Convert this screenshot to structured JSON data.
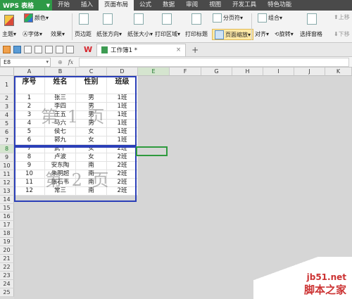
{
  "menubar": {
    "app_label": "WPS 表格",
    "items": [
      "开始",
      "插入",
      "页面布局",
      "公式",
      "数据",
      "审阅",
      "视图",
      "开发工具",
      "特色功能"
    ]
  },
  "ribbon": {
    "theme_color": "颜色",
    "theme": "主题",
    "font": "字体",
    "effect": "效果",
    "margins": "页边距",
    "orientation": "纸张方向",
    "size": "纸张大小",
    "print_area": "打印区域",
    "print_titles": "打印标题",
    "page_break": "分页符",
    "page_zoom": "页面缩放",
    "group": "组合",
    "align": "对齐",
    "rotate": "旋转",
    "selection_pane": "选择窗格",
    "bring_forward": "上移",
    "send_backward": "下移"
  },
  "tabbar": {
    "logo": "W",
    "doc_name": "工作簿1 *",
    "close": "×",
    "new_tab": "+"
  },
  "formula_bar": {
    "name_box": "E8",
    "fx": "fx",
    "value": ""
  },
  "grid": {
    "columns": [
      "A",
      "B",
      "C",
      "D",
      "E",
      "F",
      "G",
      "H",
      "I",
      "J",
      "K"
    ],
    "rows": [
      "1",
      "2",
      "3",
      "4",
      "5",
      "6",
      "7",
      "8",
      "9",
      "10",
      "11",
      "12",
      "13",
      "14",
      "15",
      "16",
      "17",
      "18",
      "19",
      "20",
      "21",
      "22",
      "23",
      "24",
      "25"
    ],
    "active_cell": "E8"
  },
  "table": {
    "headers": [
      "序号",
      "姓名",
      "性别",
      "班级"
    ],
    "rows": [
      [
        "1",
        "张三",
        "男",
        "1班"
      ],
      [
        "2",
        "李四",
        "男",
        "1班"
      ],
      [
        "3",
        "王五",
        "男",
        "1班"
      ],
      [
        "4",
        "马六",
        "男",
        "1班"
      ],
      [
        "5",
        "侯七",
        "女",
        "1班"
      ],
      [
        "6",
        "郭九",
        "女",
        "1班"
      ],
      [
        "7",
        "武十",
        "女",
        "2班"
      ],
      [
        "8",
        "卢波",
        "女",
        "2班"
      ],
      [
        "9",
        "安东陶",
        "南",
        "2班"
      ],
      [
        "10",
        "朱明超",
        "南",
        "2班"
      ],
      [
        "11",
        "张石韦",
        "南",
        "2班"
      ],
      [
        "12",
        "常三",
        "南",
        "2班"
      ]
    ]
  },
  "watermarks": {
    "page1": "第 1 页",
    "page2": "第 2 页"
  },
  "site": {
    "line1": "jb51.net",
    "line2": "脚本之家"
  }
}
